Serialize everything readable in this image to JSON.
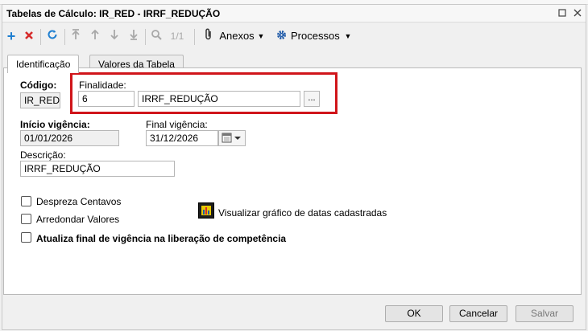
{
  "window": {
    "title": "Tabelas de Cálculo: IR_RED - IRRF_REDUÇÃO"
  },
  "toolbar": {
    "page_indicator": "1/1",
    "anexos_label": "Anexos",
    "processos_label": "Processos"
  },
  "tabs": [
    {
      "label": "Identificação",
      "active": true
    },
    {
      "label": "Valores da Tabela",
      "active": false
    }
  ],
  "form": {
    "codigo_label": "Código:",
    "codigo_value": "IR_RED",
    "finalidade_label": "Finalidade:",
    "finalidade_code": "6",
    "finalidade_desc": "IRRF_REDUÇÃO",
    "browse_label": "...",
    "inicio_label": "Início vigência:",
    "inicio_value": "01/01/2026",
    "final_label": "Final vigência:",
    "final_value": "31/12/2026",
    "descricao_label": "Descrição:",
    "descricao_value": "IRRF_REDUÇÃO",
    "despreza_label": "Despreza Centavos",
    "arredondar_label": "Arredondar Valores",
    "atualiza_label": "Atualiza final de vigência na liberação de competência",
    "grafico_label": "Visualizar gráfico de datas cadastradas"
  },
  "footer": {
    "ok_label": "OK",
    "cancel_label": "Cancelar",
    "save_label": "Salvar"
  },
  "colors": {
    "highlight_border": "#d0151a",
    "add_icon": "#1f7fd0",
    "delete_icon": "#d62b2b"
  }
}
